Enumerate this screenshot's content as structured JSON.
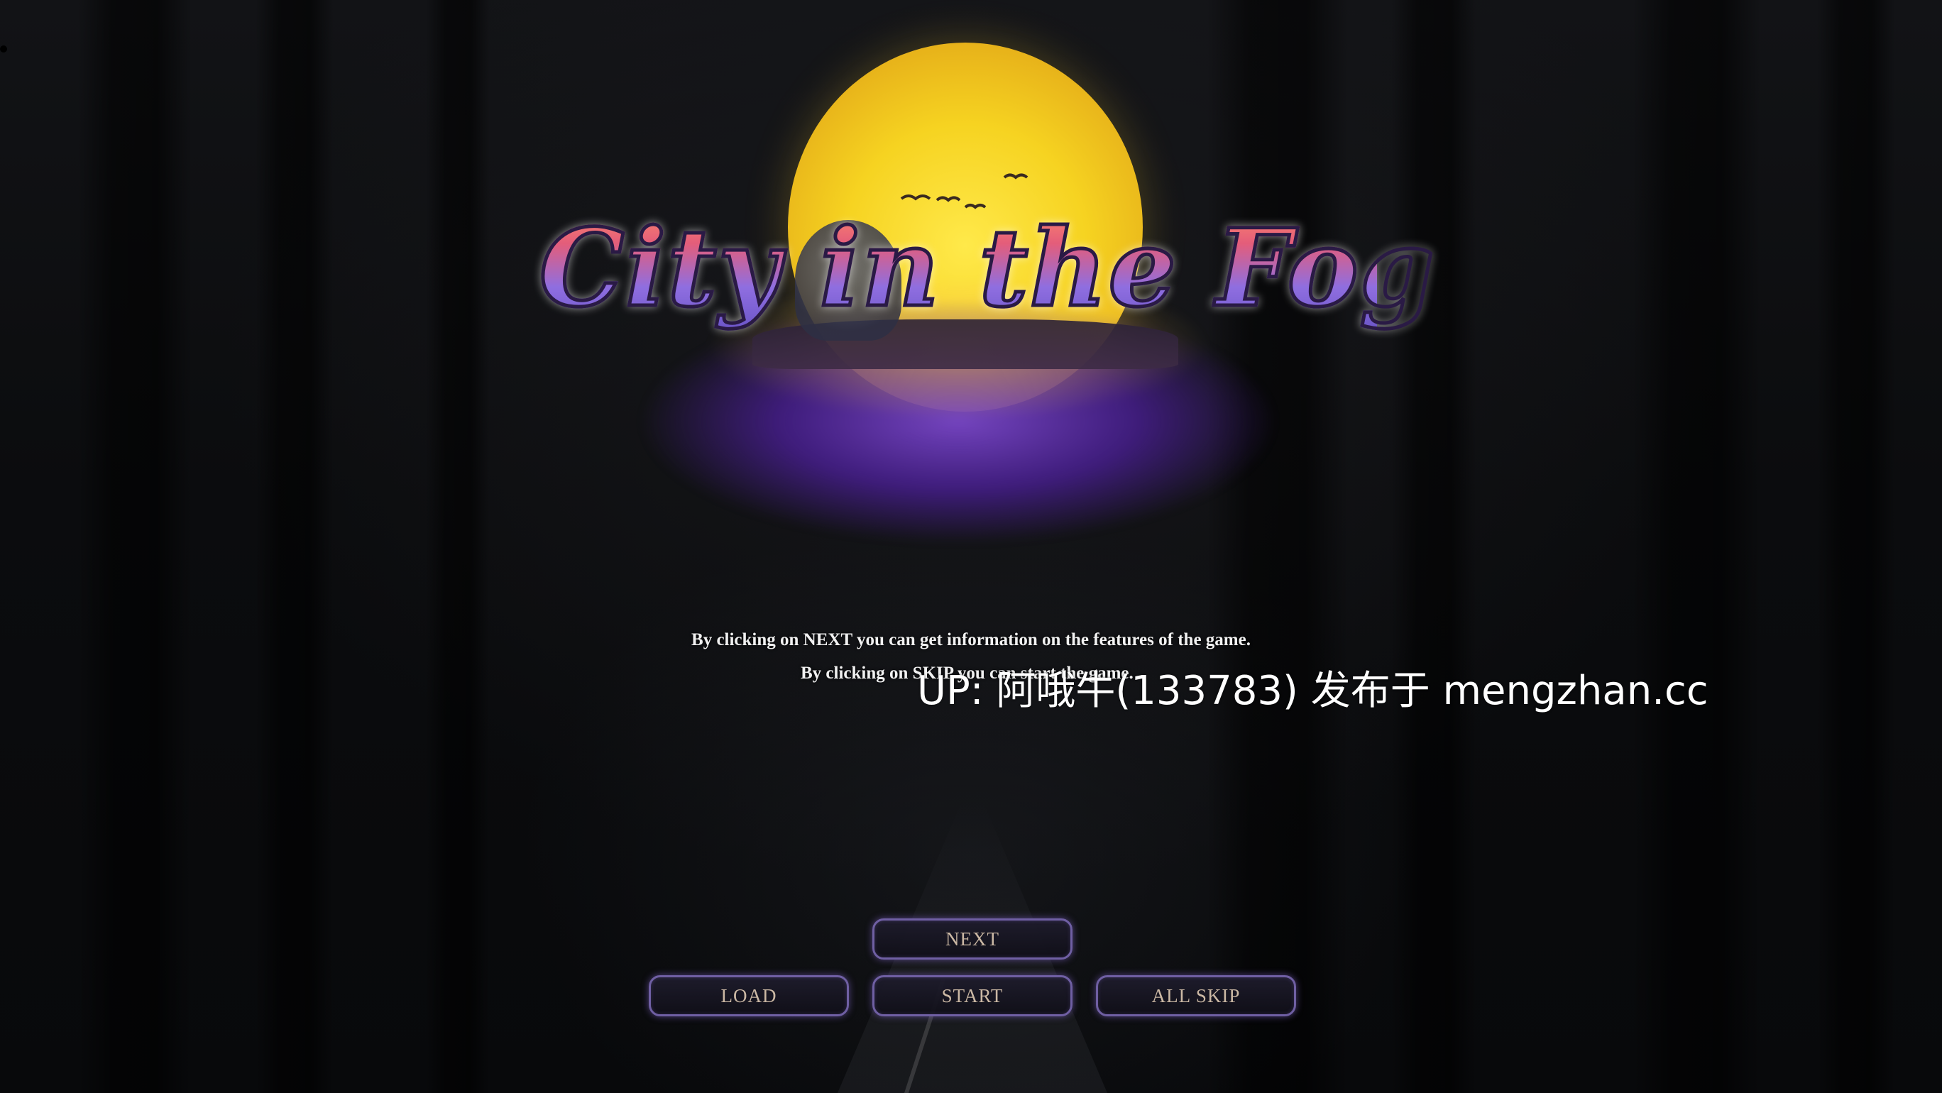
{
  "game": {
    "logo_title": "City in the Fog"
  },
  "instructions": {
    "line1": "By clicking on NEXT you can get information on the features of the game.",
    "line2": "By clicking on SKIP you can start the game."
  },
  "watermark": {
    "text": "UP: 阿哦牛(133783) 发布于 mengzhan.cc"
  },
  "buttons": {
    "next": "NEXT",
    "load": "LOAD",
    "start": "START",
    "all_skip": "ALL SKIP"
  },
  "colors": {
    "moon": "#f6d321",
    "mist": "#7a46c8",
    "button_border": "#6f5fa3",
    "button_text": "#cbb8a4"
  }
}
